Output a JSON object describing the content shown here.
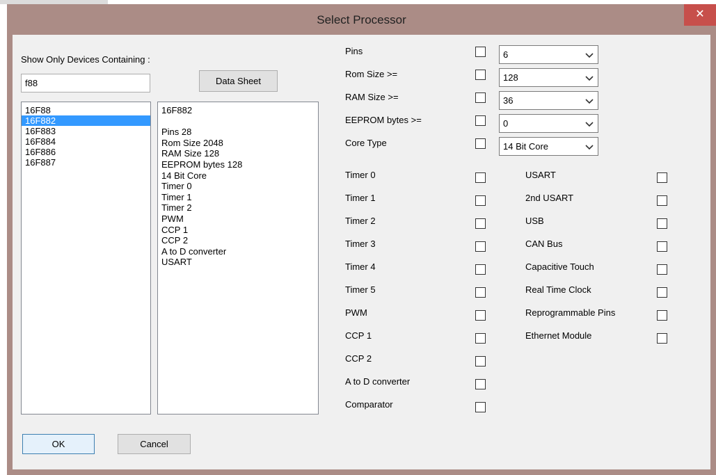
{
  "window": {
    "title": "Select Processor",
    "close_glyph": "✕"
  },
  "filter": {
    "label": "Show Only Devices Containing :",
    "value": "f88"
  },
  "datasheet_button": "Data Sheet",
  "devices": {
    "items": [
      "16F88",
      "16F882",
      "16F883",
      "16F884",
      "16F886",
      "16F887"
    ],
    "selected_index": 1
  },
  "details": {
    "lines": [
      "16F882",
      "",
      "Pins 28",
      "Rom Size 2048",
      "RAM Size 128",
      "EEPROM bytes 128",
      "14 Bit Core",
      "Timer 0",
      "Timer 1",
      "Timer 2",
      "PWM",
      "CCP 1",
      "CCP 2",
      "A to D converter",
      "USART"
    ]
  },
  "filters": [
    {
      "label": "Pins",
      "checked": false,
      "value": "6"
    },
    {
      "label": "Rom Size >=",
      "checked": false,
      "value": "128"
    },
    {
      "label": "RAM Size >=",
      "checked": false,
      "value": "36"
    },
    {
      "label": "EEPROM bytes >=",
      "checked": false,
      "value": "0"
    },
    {
      "label": "Core Type",
      "checked": false,
      "value": "14 Bit Core"
    }
  ],
  "features_left": [
    {
      "label": "Timer 0",
      "checked": false
    },
    {
      "label": "Timer 1",
      "checked": false
    },
    {
      "label": "Timer 2",
      "checked": false
    },
    {
      "label": "Timer 3",
      "checked": false
    },
    {
      "label": "Timer 4",
      "checked": false
    },
    {
      "label": "Timer 5",
      "checked": false
    },
    {
      "label": "PWM",
      "checked": false
    },
    {
      "label": "CCP 1",
      "checked": false
    },
    {
      "label": "CCP 2",
      "checked": false
    },
    {
      "label": "A to D converter",
      "checked": false
    },
    {
      "label": "Comparator",
      "checked": false
    }
  ],
  "features_right": [
    {
      "label": "USART",
      "checked": false
    },
    {
      "label": "2nd USART",
      "checked": false
    },
    {
      "label": "USB",
      "checked": false
    },
    {
      "label": "CAN Bus",
      "checked": false
    },
    {
      "label": "Capacitive Touch",
      "checked": false
    },
    {
      "label": "Real Time Clock",
      "checked": false
    },
    {
      "label": "Reprogrammable Pins",
      "checked": false
    },
    {
      "label": "Ethernet Module",
      "checked": false
    }
  ],
  "buttons": {
    "ok": "OK",
    "cancel": "Cancel"
  },
  "colors": {
    "titlebar": "#ab8c86",
    "close": "#c74f4b",
    "selection": "#3399ff"
  },
  "icons": {
    "close": "close-icon",
    "dropdown": "chevron-down-icon"
  }
}
